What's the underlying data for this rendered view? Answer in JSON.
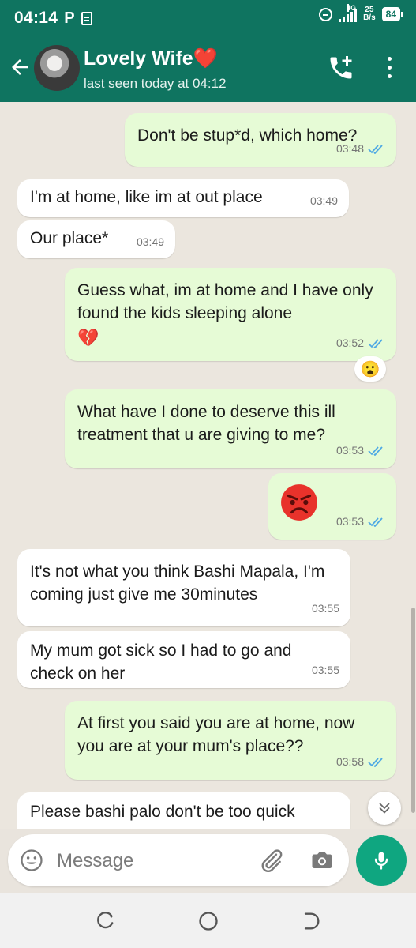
{
  "status_bar": {
    "time": "04:14",
    "p_label": "P",
    "network": "4G",
    "speed_value": "25",
    "speed_unit": "B/s",
    "battery": "84"
  },
  "header": {
    "contact_name": "Lovely Wife",
    "heart": "❤️",
    "last_seen": "last seen today at 04:12"
  },
  "messages": [
    {
      "text": "Don't be stup*d,  which home?",
      "time": "03:48"
    },
    {
      "text": "I'm at home, like im at out place",
      "time": "03:49"
    },
    {
      "text": "Our place*",
      "time": "03:49"
    },
    {
      "text": "Guess what, im at home and I have only found the kids sleeping alone",
      "emoji": "💔",
      "time": "03:52"
    },
    {
      "text": "What have I done to deserve this ill treatment that u are giving to me?",
      "time": "03:53"
    },
    {
      "time": "03:53"
    },
    {
      "text": "It's not what you think Bashi Mapala, I'm coming just give me 30minutes",
      "time": "03:55"
    },
    {
      "text": "My mum got sick so I had to go and check on her",
      "time": "03:55"
    },
    {
      "text": "At first you said you are at home, now you are at your mum's place??",
      "time": "03:58"
    },
    {
      "text": "Please bashi palo don't be too quick"
    }
  ],
  "reaction": {
    "emoji": "😮"
  },
  "input": {
    "placeholder": "Message"
  },
  "colors": {
    "header": "#0f7460",
    "outgoing_bubble": "#e6fbd6",
    "incoming_bubble": "#ffffff",
    "chat_background": "#ebe6de",
    "mic_button": "#0fa680",
    "read_ticks": "#4fa9e4"
  },
  "icons": [
    "back-arrow-icon",
    "call-add-icon",
    "more-vert-icon",
    "emoji-icon",
    "attach-icon",
    "camera-icon",
    "mic-icon",
    "chevron-double-down-icon"
  ]
}
